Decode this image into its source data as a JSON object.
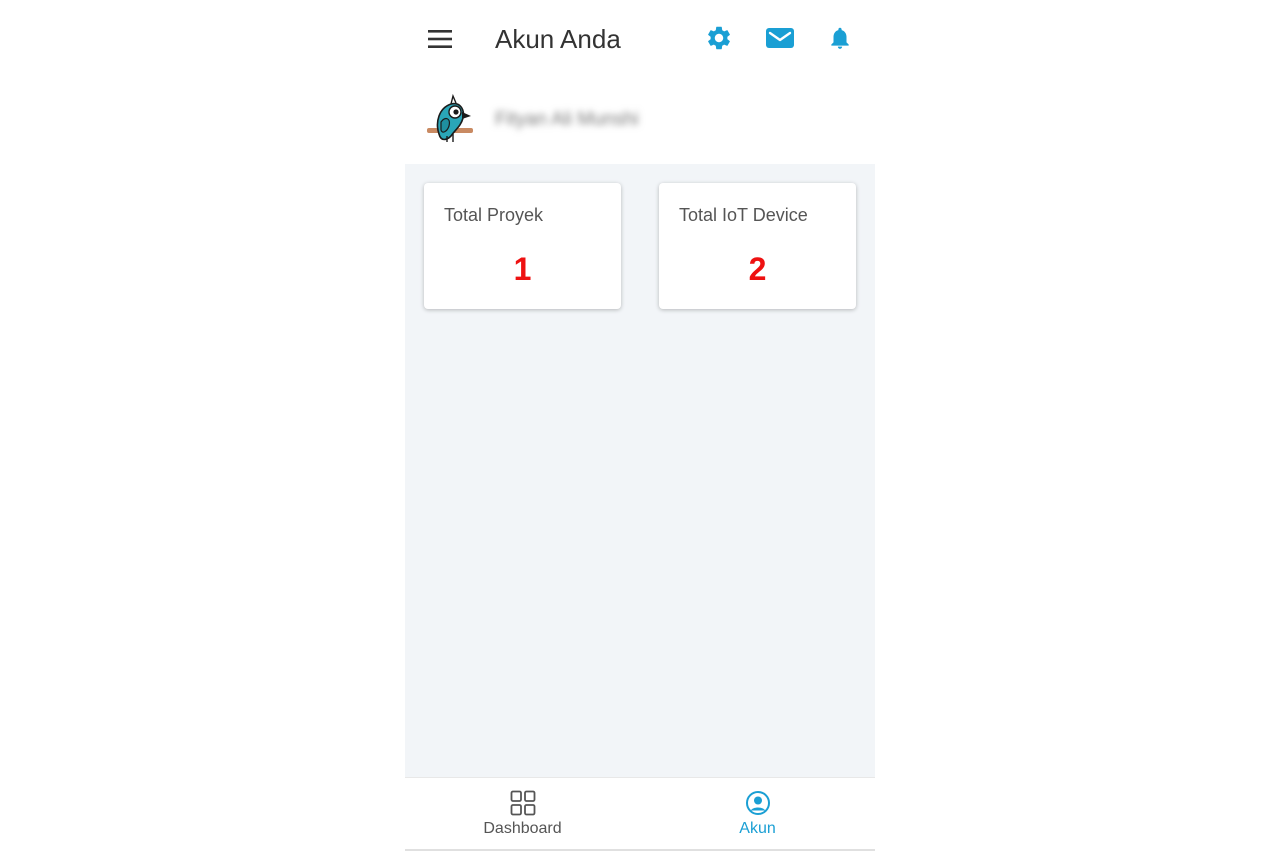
{
  "header": {
    "title": "Akun Anda",
    "icons": [
      "menu-icon",
      "gear-icon",
      "mail-icon",
      "bell-icon"
    ]
  },
  "profile": {
    "name": "Fityan Ali Munshi"
  },
  "cards": [
    {
      "label": "Total Proyek",
      "value": "1"
    },
    {
      "label": "Total IoT Device",
      "value": "2"
    }
  ],
  "bottom_nav": {
    "items": [
      {
        "label": "Dashboard",
        "icon": "grid-icon",
        "active": false
      },
      {
        "label": "Akun",
        "icon": "user-circle-icon",
        "active": true
      }
    ]
  },
  "colors": {
    "accent": "#1a9fd4",
    "value_red": "#ee1111",
    "content_bg": "#f2f5f8"
  }
}
